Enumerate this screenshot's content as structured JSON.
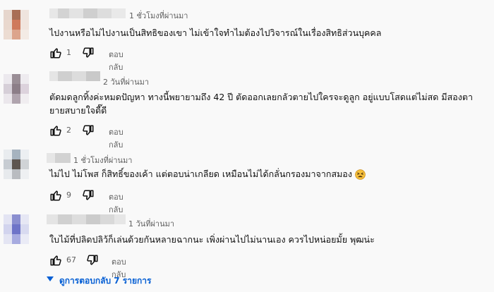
{
  "comments": [
    {
      "time": "1 ชั่วโมงที่ผ่านมา",
      "text": "ไปงานหรือไม่ไปงานเป็นสิทธิของเขา ไม่เข้าใจทำไมต้องไปวิจารณ์ในเรื่องสิทธิส่วนบุคคล",
      "likes": "1",
      "reply_label": "ตอบกลับ"
    },
    {
      "time": "2 วันที่ผ่านมา",
      "text_line1": "ตัดมดลูกทิ้งค่ะหมดปัญหา ทางนี้พยายามถึง 42 ปี ตัดออกเลยกลัวตายไปใครจะดูลูก อยู่แบบโสดแต่ไม่สด มีสองตา",
      "text_line2": "ยายสบายใจดี๊ดี",
      "likes": "2",
      "reply_label": "ตอบกลับ"
    },
    {
      "time": "1 ชั่วโมงที่ผ่านมา",
      "text": "ไม่ไป ไม่โพส ก็สิทธิ์ของเค้า แต่ตอบน่าเกลียด เหมือนไม่ได้กลั่นกรองมาจากสมอง",
      "emoji": "tired-face-emoji",
      "likes": "9",
      "reply_label": "ตอบกลับ"
    },
    {
      "time": "1 วันที่ผ่านมา",
      "text": "ใบไม้ที่ปลิดปลิว้ก็เล่นด้วยกันหลายฉากนะ เพิ่งผ่านไปไม่นานเอง ควรไปหน่อยมั้ย พุฒน่ะ",
      "likes": "67",
      "reply_label": "ตอบกลับ"
    }
  ],
  "more_replies_label": "ดูการตอบกลับ 7 รายการ",
  "icons": {
    "like": "thumbs-up-icon",
    "dislike": "thumbs-down-icon",
    "caret": "caret-down-icon"
  },
  "colors": {
    "background": "#f9f9f9",
    "text": "#0f0f0f",
    "meta": "#606060",
    "link": "#065fd4"
  }
}
